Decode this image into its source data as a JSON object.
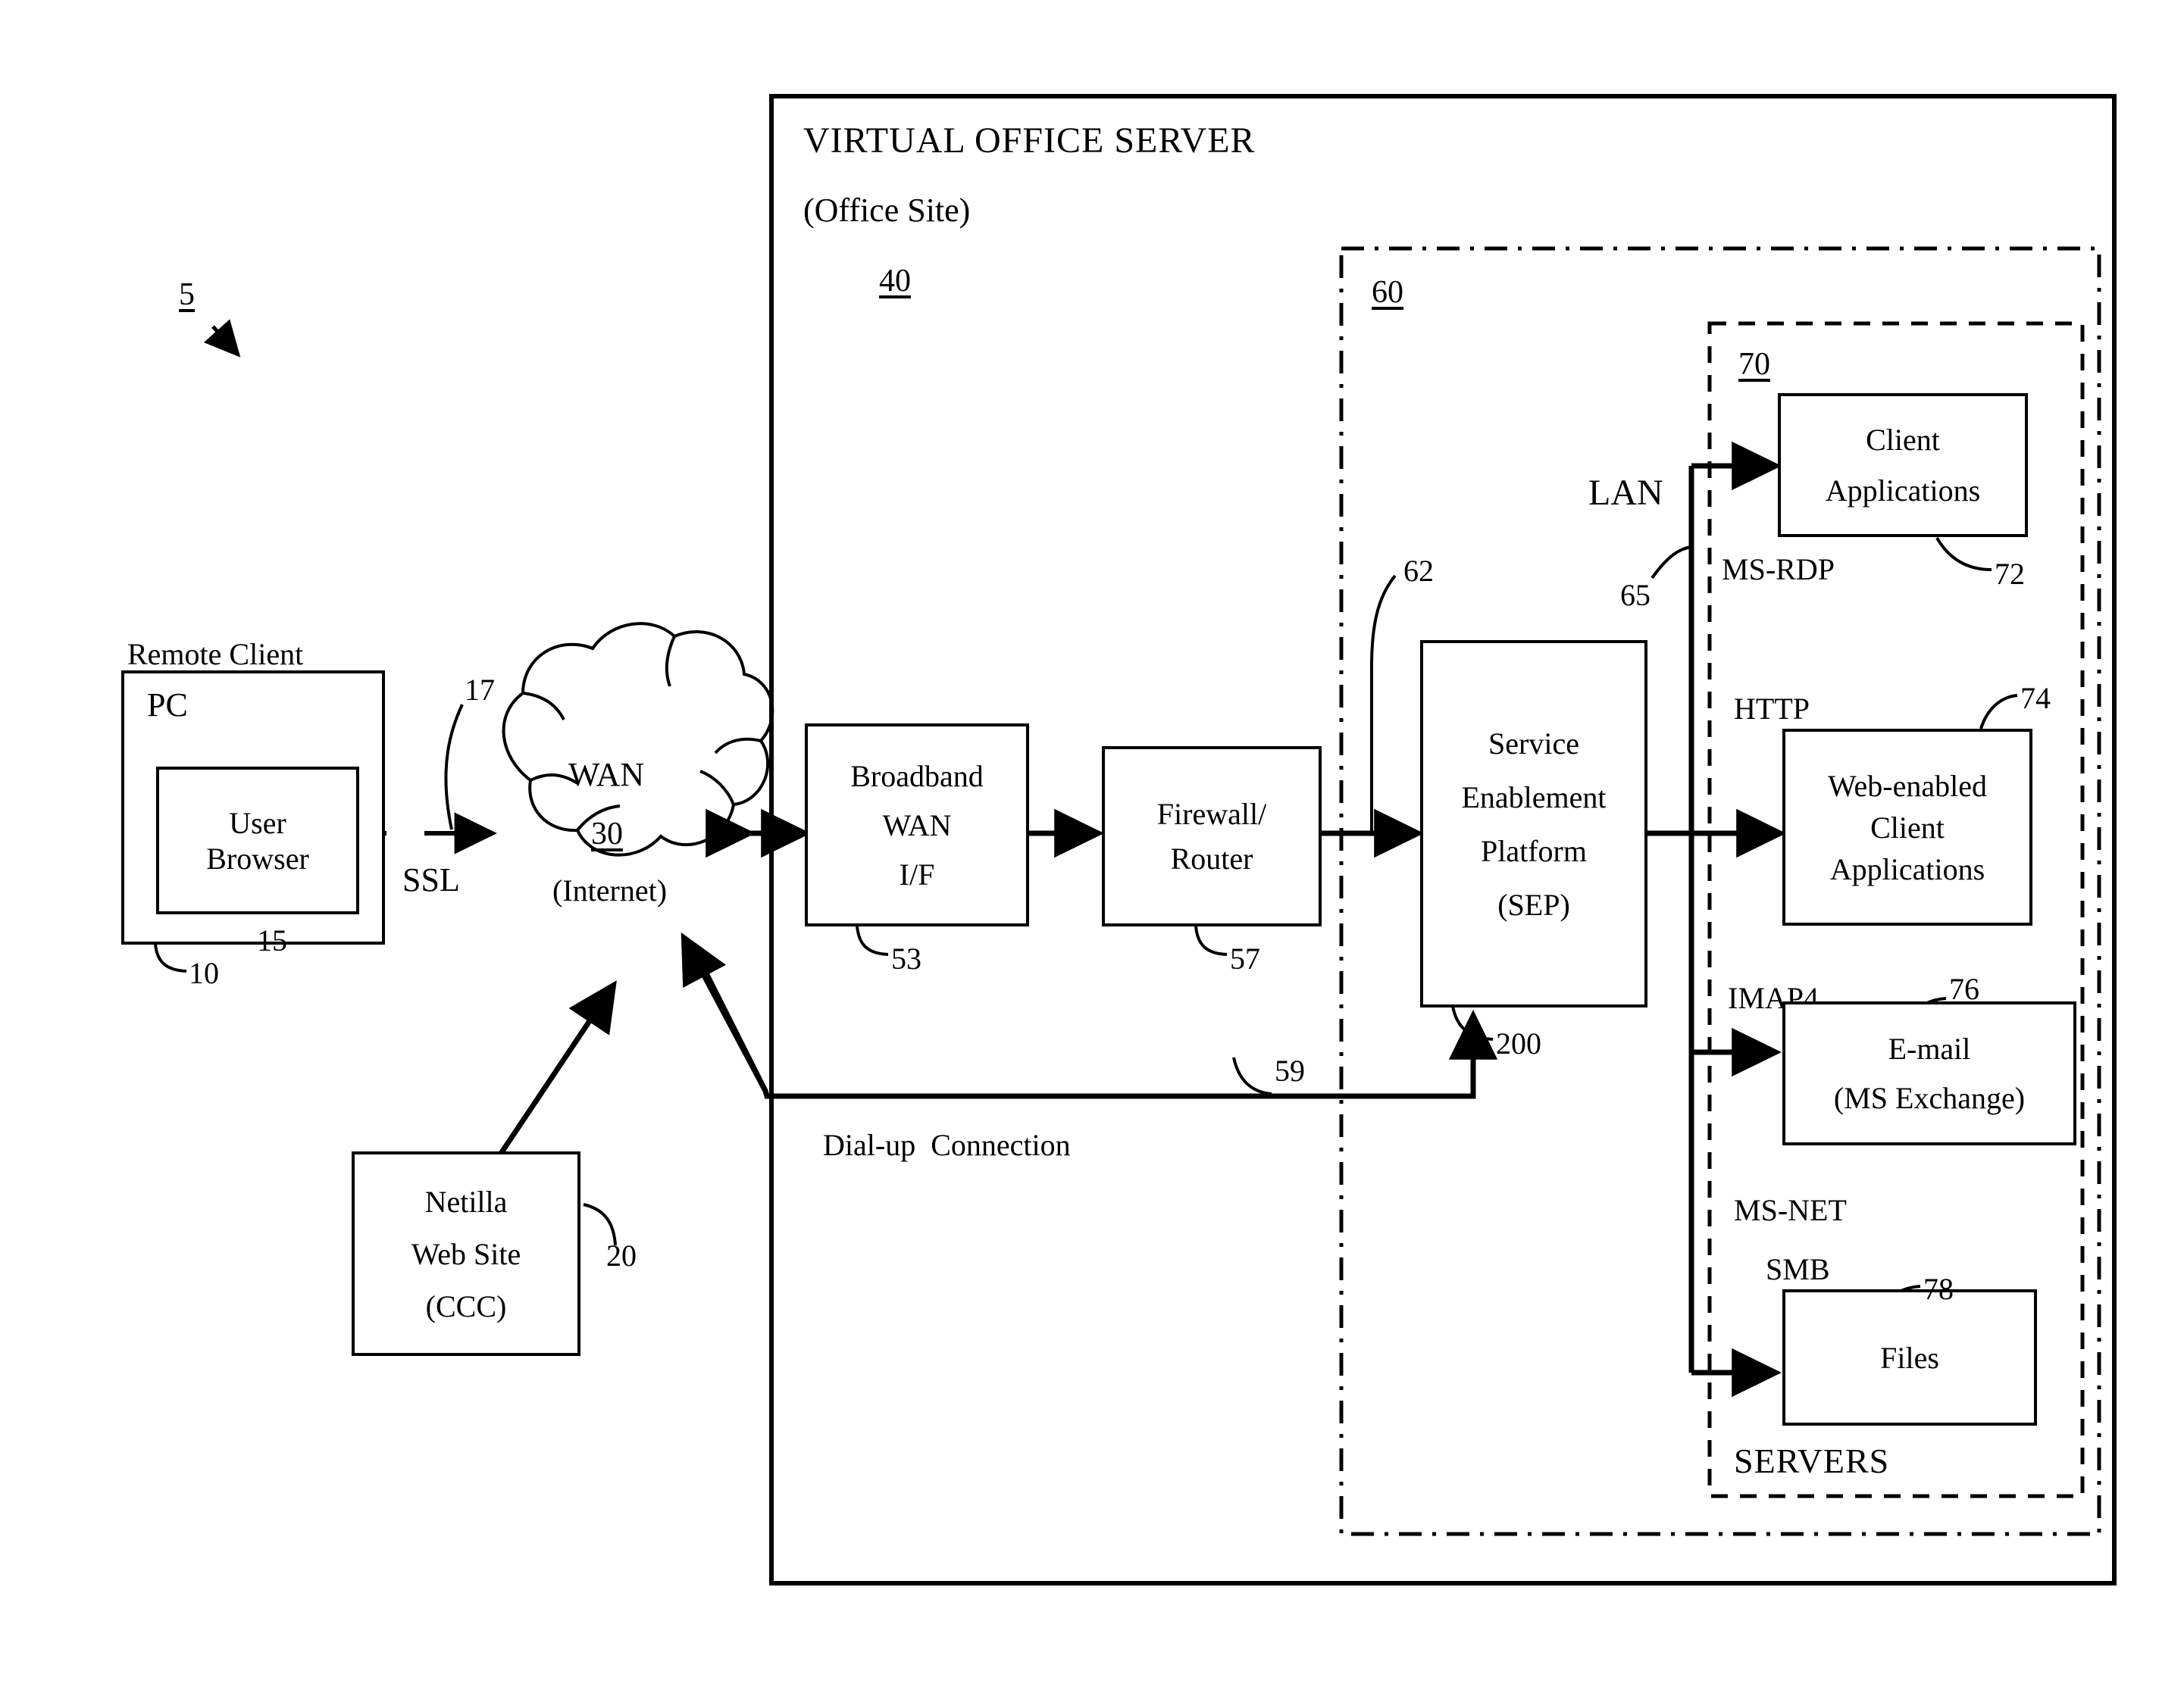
{
  "figure": {
    "figure_ref": "5",
    "title": "VIRTUAL OFFICE SERVER",
    "subtitle": "(Office Site)",
    "server_ref": "40"
  },
  "remote_client": {
    "caption": "Remote Client",
    "pc_label": "PC",
    "pc_ref": "10",
    "browser_line1": "User",
    "browser_line2": "Browser",
    "browser_ref": "15",
    "link_ref": "17",
    "link_protocol": "SSL"
  },
  "wan": {
    "name": "WAN",
    "ref": "30",
    "sub": "(Internet)"
  },
  "netilla": {
    "line1": "Netilla",
    "line2": "Web Site",
    "line3": "(CCC)",
    "ref": "20"
  },
  "office": {
    "broadband": {
      "line1": "Broadband",
      "line2": "WAN",
      "line3": "I/F",
      "ref": "53"
    },
    "firewall": {
      "line1": "Firewall/",
      "line2": "Router",
      "ref": "57"
    },
    "sep": {
      "line1": "Service",
      "line2": "Enablement",
      "line3": "Platform",
      "line4": "(SEP)",
      "ref": "200",
      "inbound_ref": "62"
    },
    "dialup": {
      "label": "Dial-up  Connection",
      "ref": "59"
    },
    "lan": {
      "label": "LAN",
      "ref": "65"
    },
    "lan_zone_ref": "60"
  },
  "servers": {
    "zone_ref": "70",
    "zone_label": "SERVERS",
    "items": [
      {
        "protocol": "MS-RDP",
        "line1": "Client",
        "line2": "Applications",
        "line3": "",
        "ref": "72"
      },
      {
        "protocol": "HTTP",
        "line1": "Web-enabled",
        "line2": "Client",
        "line3": "Applications",
        "ref": "74"
      },
      {
        "protocol": "IMAP4",
        "line1": "E-mail",
        "line2": "(MS Exchange)",
        "line3": "",
        "ref": "76"
      },
      {
        "protocol_primary": "MS-NET",
        "protocol": "SMB",
        "line1": "Files",
        "line2": "",
        "line3": "",
        "ref": "78"
      }
    ]
  },
  "colors": {
    "ink": "#000000",
    "paper": "#ffffff"
  }
}
